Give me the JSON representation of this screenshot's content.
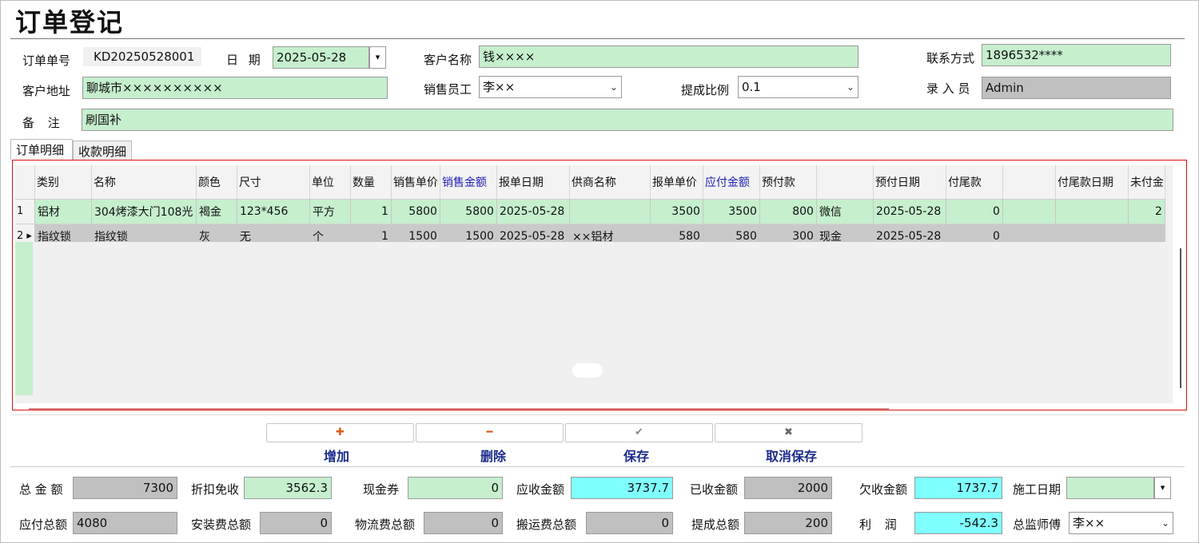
{
  "title": "订单登记",
  "header": {
    "order_no_label": "订单单号",
    "order_no": "KD20250528001",
    "date_label": "日  期",
    "date": "2025-05-28",
    "customer_label": "客户名称",
    "customer": "钱××××",
    "contact_label": "联系方式",
    "contact": "1896532****",
    "address_label": "客户地址",
    "address": "聊城市××××××××××",
    "salesperson_label": "销售员工",
    "salesperson": "李××",
    "commission_label": "提成比例",
    "commission": "0.1",
    "entered_by_label": "录 入 员",
    "entered_by": "Admin",
    "note_label": "备    注",
    "note": "刷国补"
  },
  "tabs": [
    "订单明细",
    "收款明细"
  ],
  "grid": {
    "columns": [
      "类别",
      "名称",
      "颜色",
      "尺寸",
      "单位",
      "数量",
      "销售单价",
      "销售金额",
      "报单日期",
      "供商名称",
      "报单单价",
      "应付金额",
      "预付款",
      "",
      "预付日期",
      "付尾款",
      "",
      "付尾款日期",
      "未付金"
    ],
    "rows": [
      {
        "rowhdr": "1",
        "cells": [
          "铝材",
          "304烤漆大门108光",
          "褐金",
          "123*456",
          "平方",
          "1",
          "5800",
          "5800",
          "2025-05-28",
          "",
          "3500",
          "3500",
          "800",
          "微信",
          "2025-05-28",
          "0",
          "",
          "",
          "2"
        ]
      },
      {
        "rowhdr": "2 ▸",
        "cells": [
          "指纹锁",
          "指纹锁",
          "灰",
          "无",
          "个",
          "1",
          "1500",
          "1500",
          "2025-05-28",
          "××铝材",
          "580",
          "580",
          "300",
          "现金",
          "2025-05-28",
          "0",
          "",
          "",
          ""
        ]
      }
    ]
  },
  "buttons": {
    "add_icon": "✚",
    "add": "增加",
    "delete_icon": "━",
    "delete": "删除",
    "save_icon": "✔",
    "save": "保存",
    "cancel_icon": "✖",
    "cancel": "取消保存"
  },
  "summary": {
    "total_label": "总 金 额",
    "total": "7300",
    "discount_label": "折扣免收",
    "discount": "3562.3",
    "coupon_label": "现金券",
    "coupon": "0",
    "receivable_label": "应收金额",
    "receivable": "3737.7",
    "received_label": "已收金额",
    "received": "2000",
    "owed_label": "欠收金额",
    "owed": "1737.7",
    "construction_date_label": "施工日期",
    "construction_date": "",
    "payable_total_label": "应付总额",
    "payable_total": "4080",
    "install_fee_label": "安装费总额",
    "install_fee": "0",
    "logistics_label": "物流费总额",
    "logistics": "0",
    "carry_label": "搬运费总额",
    "carry": "0",
    "commission_total_label": "提成总额",
    "commission_total": "200",
    "profit_label": "利    润",
    "profit": "-542.3",
    "supervisor_label": "总监师傅",
    "supervisor": "李××"
  },
  "colors": {
    "green": "#c6efce",
    "gray": "#c0c0c0",
    "cyan": "#80ffff",
    "frame_red": "#d11111",
    "blue_text": "#1a2a8c"
  }
}
